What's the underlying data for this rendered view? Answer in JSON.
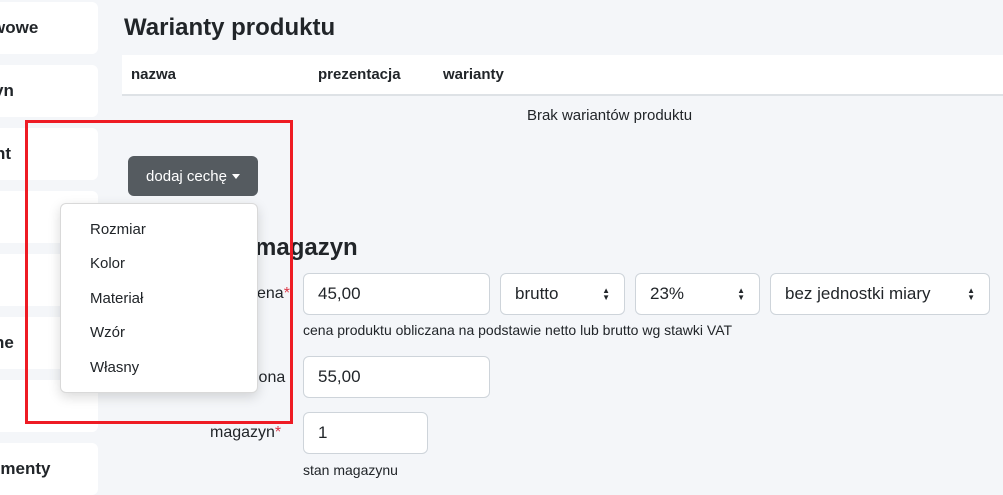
{
  "sidebar": {
    "cards": [
      {
        "label": "wowe"
      },
      {
        "label": "yn"
      },
      {
        "label": "nt"
      },
      {
        "label": ""
      },
      {
        "label": ""
      },
      {
        "label": "ne"
      },
      {
        "label": ""
      },
      {
        "label": "umenty"
      }
    ]
  },
  "variants": {
    "title": "Warianty produktu",
    "columns": [
      "nazwa",
      "prezentacja",
      "warianty"
    ],
    "empty_text": "Brak wariantów produktu",
    "add_button": "dodaj cechę",
    "menu_items": [
      "Rozmiar",
      "Kolor",
      "Materiał",
      "Wzór",
      "Własny"
    ]
  },
  "stock": {
    "title": "magazyn",
    "price_label": "ena",
    "price_value": "45,00",
    "tax_mode": "brutto",
    "vat_rate": "23%",
    "unit": "bez jednostki miary",
    "price_help": "cena produktu obliczana na podstawie netto lub brutto wg stawki VAT",
    "crossed_label": "lona",
    "crossed_value": "55,00",
    "stock_label": "magazyn",
    "stock_value": "1",
    "stock_help": "stan magazynu",
    "required_mark": "*"
  },
  "colors": {
    "highlight": "#ee1b24",
    "button_dark": "#555b60",
    "required": "#dc3545"
  }
}
